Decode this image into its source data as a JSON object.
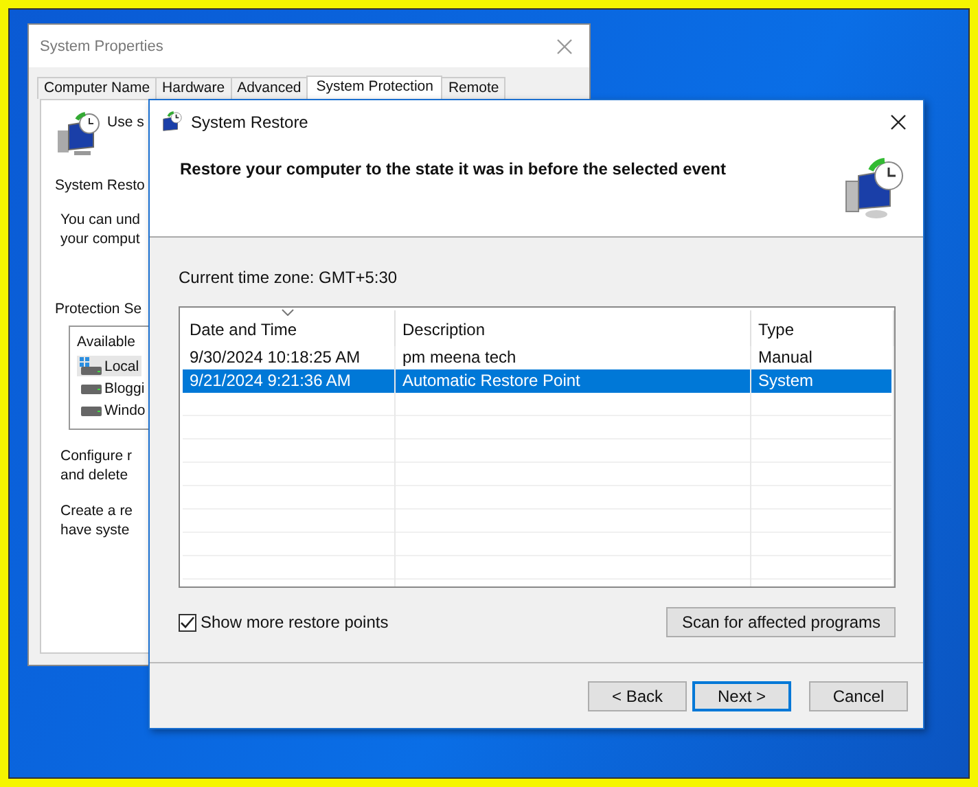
{
  "back_window": {
    "title": "System Properties",
    "tabs": [
      {
        "label": "Computer Name",
        "selected": false
      },
      {
        "label": "Hardware",
        "selected": false
      },
      {
        "label": "Advanced",
        "selected": false
      },
      {
        "label": "System Protection",
        "selected": true
      },
      {
        "label": "Remote",
        "selected": false
      }
    ],
    "intro": "Use s",
    "section_title": "System Resto",
    "section_text": [
      "You can und",
      "your comput"
    ],
    "protection_title": "Protection Se",
    "list_header": "Available",
    "drives": [
      {
        "label": "Local",
        "kind": "system",
        "selected": true
      },
      {
        "label": "Bloggi",
        "kind": "disk",
        "selected": false
      },
      {
        "label": "Windo",
        "kind": "disk",
        "selected": false
      }
    ],
    "configure_text": [
      "Configure r",
      "and delete"
    ],
    "create_text": [
      "Create a re",
      "have syste"
    ]
  },
  "dialog": {
    "title": "System Restore",
    "heading": "Restore your computer to the state it was in before the selected event",
    "timezone": "Current time zone: GMT+5:30",
    "table": {
      "columns": [
        "Date and Time",
        "Description",
        "Type"
      ],
      "rows": [
        {
          "cells": [
            "9/30/2024 10:18:25 AM",
            "pm meena tech",
            "Manual"
          ],
          "selected": false
        },
        {
          "cells": [
            "9/21/2024 9:21:36 AM",
            "Automatic Restore Point",
            "System"
          ],
          "selected": true
        }
      ]
    },
    "show_more": {
      "label": "Show more restore points",
      "checked": true
    },
    "scan_button": "Scan for affected programs",
    "buttons": [
      {
        "label": "< Back",
        "default": false
      },
      {
        "label": "Next >",
        "default": true
      },
      {
        "label": "Cancel",
        "default": false
      }
    ]
  }
}
